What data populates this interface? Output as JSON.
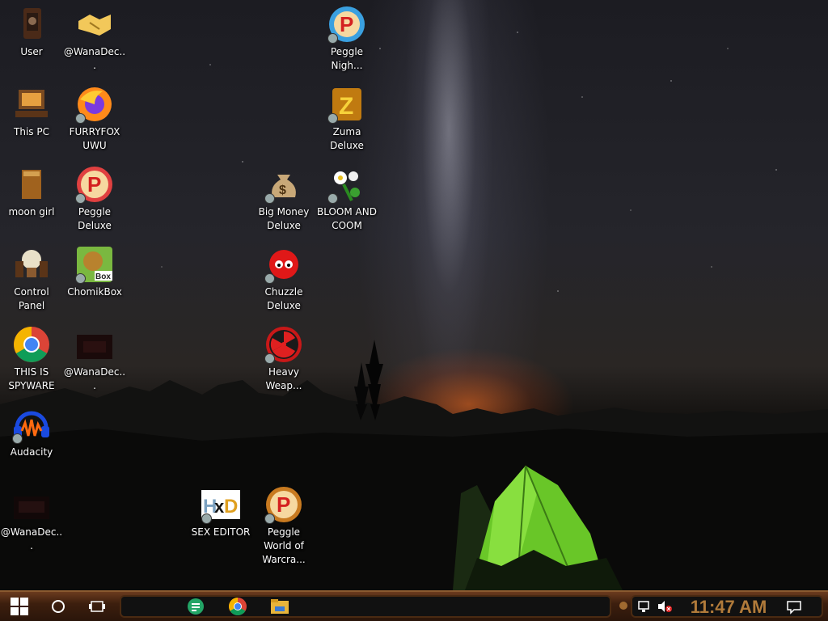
{
  "desktop": {
    "icons": [
      {
        "label": "User"
      },
      {
        "label": "@WanaDec..."
      },
      {
        "label": "Peggle Nigh..."
      },
      {
        "label": "This PC"
      },
      {
        "label": "FURRYFOX UWU"
      },
      {
        "label": "Zuma Deluxe"
      },
      {
        "label": "moon girl"
      },
      {
        "label": "Peggle Deluxe"
      },
      {
        "label": "Big Money Deluxe"
      },
      {
        "label": "BLOOM AND COOM"
      },
      {
        "label": "Control Panel"
      },
      {
        "label": "ChomikBox"
      },
      {
        "label": "Chuzzle Deluxe"
      },
      {
        "label": "THIS IS SPYWARE"
      },
      {
        "label": "@WanaDec..."
      },
      {
        "label": "Heavy Weap..."
      },
      {
        "label": "Audacity"
      },
      {
        "label": "@WanaDec..."
      },
      {
        "label": "SEX EDITOR"
      },
      {
        "label": "Peggle World of Warcra..."
      }
    ]
  },
  "taskbar": {
    "start_icon": "windows-logo-icon",
    "search_icon": "cortana-circle-icon",
    "taskview_icon": "task-view-icon",
    "pinned": [
      {
        "icon": "google-sheets-icon"
      },
      {
        "icon": "chrome-icon"
      },
      {
        "icon": "file-explorer-icon"
      }
    ],
    "clock": "11:47 AM"
  },
  "colors": {
    "taskbar_brown": "#3d1f0e",
    "clock_text": "#b07a3a",
    "tent_green": "#6fd12a"
  }
}
